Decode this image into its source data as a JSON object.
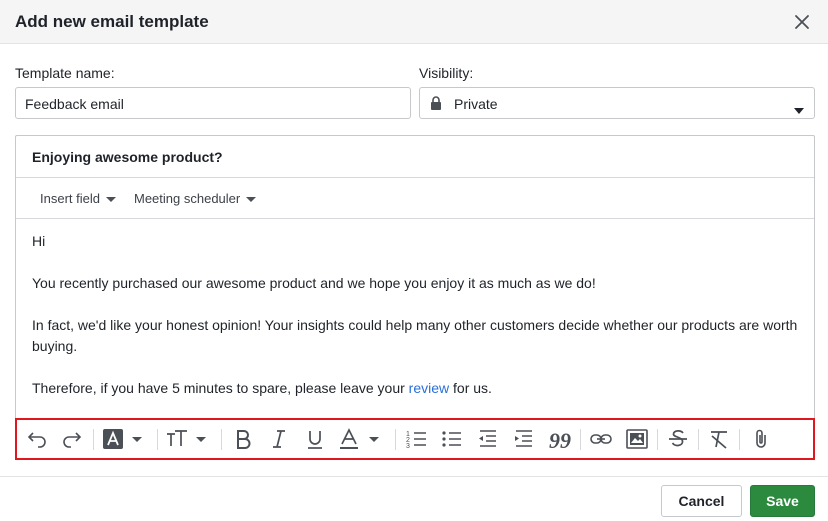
{
  "dialog": {
    "title": "Add new email template"
  },
  "form": {
    "template_name_label": "Template name:",
    "template_name_value": "Feedback email",
    "visibility_label": "Visibility:",
    "visibility_value": "Private"
  },
  "editor": {
    "subject": "Enjoying awesome product?",
    "insert_field_label": "Insert field",
    "meeting_scheduler_label": "Meeting scheduler",
    "body": {
      "greeting": "Hi",
      "paragraph1": "You recently purchased our awesome product and we hope you enjoy it as much as we do!",
      "paragraph2": "In fact, we'd like your honest opinion! Your insights could help many other customers decide whether our products are worth buying.",
      "paragraph3_before": "Therefore, if you have 5 minutes to spare, please leave your ",
      "paragraph3_link": "review",
      "paragraph3_after": " for us."
    }
  },
  "toolbar": {
    "tools": [
      "undo-icon",
      "redo-icon",
      "highlight-color-icon",
      "font-size-icon",
      "bold-icon",
      "italic-icon",
      "underline-icon",
      "text-color-icon",
      "numbered-list-icon",
      "bulleted-list-icon",
      "outdent-icon",
      "indent-icon",
      "quote-icon",
      "link-icon",
      "image-icon",
      "strikethrough-icon",
      "clear-formatting-icon",
      "attachment-icon"
    ]
  },
  "footer": {
    "cancel_label": "Cancel",
    "save_label": "Save"
  },
  "colors": {
    "accent_green": "#2b8a3e",
    "highlight_border": "#e0171f",
    "link_blue": "#2a6fd6"
  }
}
